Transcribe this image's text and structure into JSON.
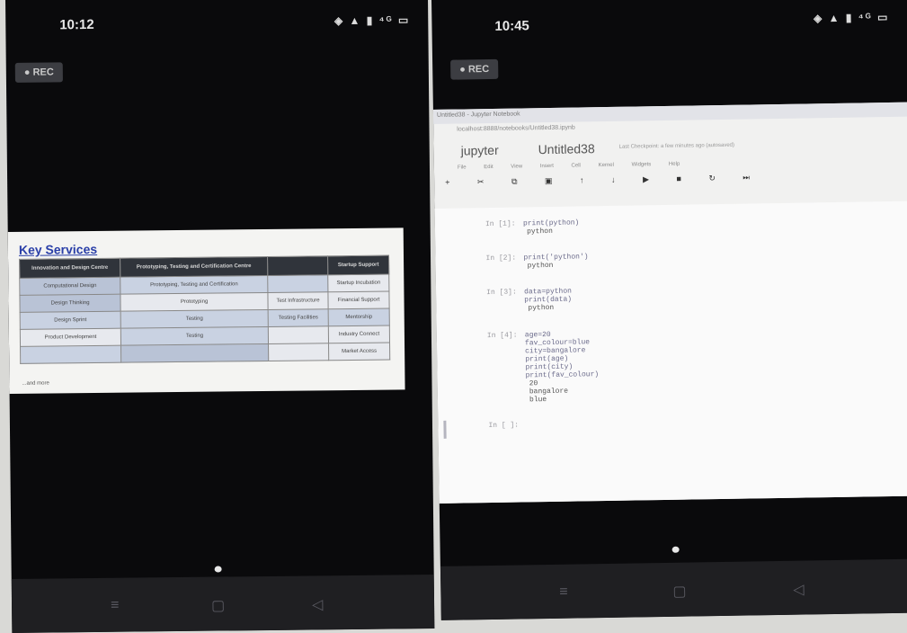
{
  "left_phone": {
    "status": {
      "time": "10:12",
      "icons": "◈ ▲ ▮ ⁴ᴳ ▭"
    },
    "rec_label": "● REC",
    "webpage": {
      "section_title": "Key Services",
      "columns": [
        "Innovation and Design Centre",
        "Prototyping, Testing and Certification Centre",
        "",
        "Startup Support"
      ],
      "rows": [
        [
          "Computational Design",
          "Prototyping, Testing and Certification",
          "",
          "Startup Incubation"
        ],
        [
          "Design Thinking",
          "Prototyping",
          "Test Infrastructure",
          "Financial Support"
        ],
        [
          "Design Sprint",
          "Testing",
          "Testing Facilities",
          "Mentorship"
        ],
        [
          "Product Development",
          "Testing",
          "",
          "Industry Connect"
        ],
        [
          "",
          "",
          "",
          "Market Access"
        ]
      ],
      "more_text": "...and more"
    },
    "nav": {
      "recent": "≡",
      "home": "▢",
      "back": "◁"
    }
  },
  "right_phone": {
    "status": {
      "time": "10:45",
      "icons": "◈ ▲ ▮ ⁴ᴳ ▭"
    },
    "rec_label": "● REC",
    "browser": {
      "tab": "Untitled38 - Jupyter Notebook",
      "url": "localhost:8888/notebooks/Untitled38.ipynb"
    },
    "jupyter": {
      "logo": "jupyter",
      "title": "Untitled38",
      "info": "Last Checkpoint: a few minutes ago (autosaved)",
      "menus": [
        "File",
        "Edit",
        "View",
        "Insert",
        "Cell",
        "Kernel",
        "Widgets",
        "Help"
      ],
      "toolbar": [
        "+",
        "✂",
        "⧉",
        "▣",
        "↑",
        "↓",
        "▶",
        "■",
        "↻",
        "⏭"
      ],
      "cells": [
        {
          "prompt": "In [1]:",
          "code": "print(python)",
          "output": "python"
        },
        {
          "prompt": "In [2]:",
          "code": "print('python')",
          "output": "python"
        },
        {
          "prompt": "In [3]:",
          "code": "data=python\nprint(data)",
          "output": "python"
        },
        {
          "prompt": "In [4]:",
          "code": "age=20\nfav_colour=blue\ncity=bangalore\nprint(age)\nprint(city)\nprint(fav_colour)",
          "output": "20\nbangalore\nblue"
        },
        {
          "prompt": "In [ ]:",
          "code": "",
          "output": ""
        }
      ]
    },
    "nav": {
      "recent": "≡",
      "home": "▢",
      "back": "◁"
    }
  }
}
